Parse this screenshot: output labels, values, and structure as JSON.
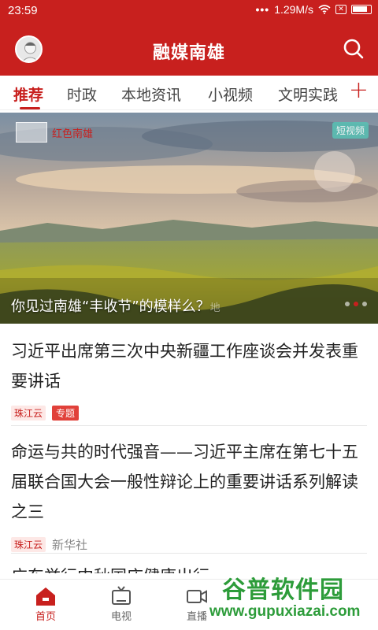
{
  "status_bar": {
    "time": "23:59",
    "speed": "1.29M/s",
    "dots": "•••"
  },
  "header": {
    "title": "融媒南雄",
    "avatar_icon": "user-avatar-icon",
    "search_icon": "search-icon"
  },
  "tabs": [
    {
      "label": "推荐",
      "active": true
    },
    {
      "label": "时政",
      "active": false
    },
    {
      "label": "本地资讯",
      "active": false
    },
    {
      "label": "小视频",
      "active": false
    },
    {
      "label": "文明实践",
      "active": false
    }
  ],
  "tab_add": "+",
  "banner": {
    "caption": "你见过南雄“丰收节”的模样么？",
    "caption_tail": "地",
    "badge": "短视频",
    "logo_text": "红色南雄",
    "slides_total": 3,
    "active_slide": 2
  },
  "news": [
    {
      "title": "习近平出席第三次中央新疆工作座谈会并发表重要讲话",
      "source_tag": "珠江云",
      "topic_tag": "专题"
    },
    {
      "title": "命运与共的时代强音——习近平主席在第七十五届联合国大会一般性辩论上的重要讲话系列解读之三",
      "source_tag": "珠江云",
      "source_text": "新华社"
    }
  ],
  "peek_title": "广东举行中秋国庆健康出行",
  "bottom_nav": [
    {
      "label": "首页",
      "icon": "home-icon",
      "active": true
    },
    {
      "label": "电视",
      "icon": "tv-icon",
      "active": false
    },
    {
      "label": "直播",
      "icon": "video-camera-icon",
      "active": false
    }
  ],
  "watermark": {
    "line1": "谷普软件园",
    "line2": "www.gupuxiazai.com"
  },
  "colors": {
    "brand_red": "#c8201e",
    "watermark_green": "#2d9c3a"
  }
}
